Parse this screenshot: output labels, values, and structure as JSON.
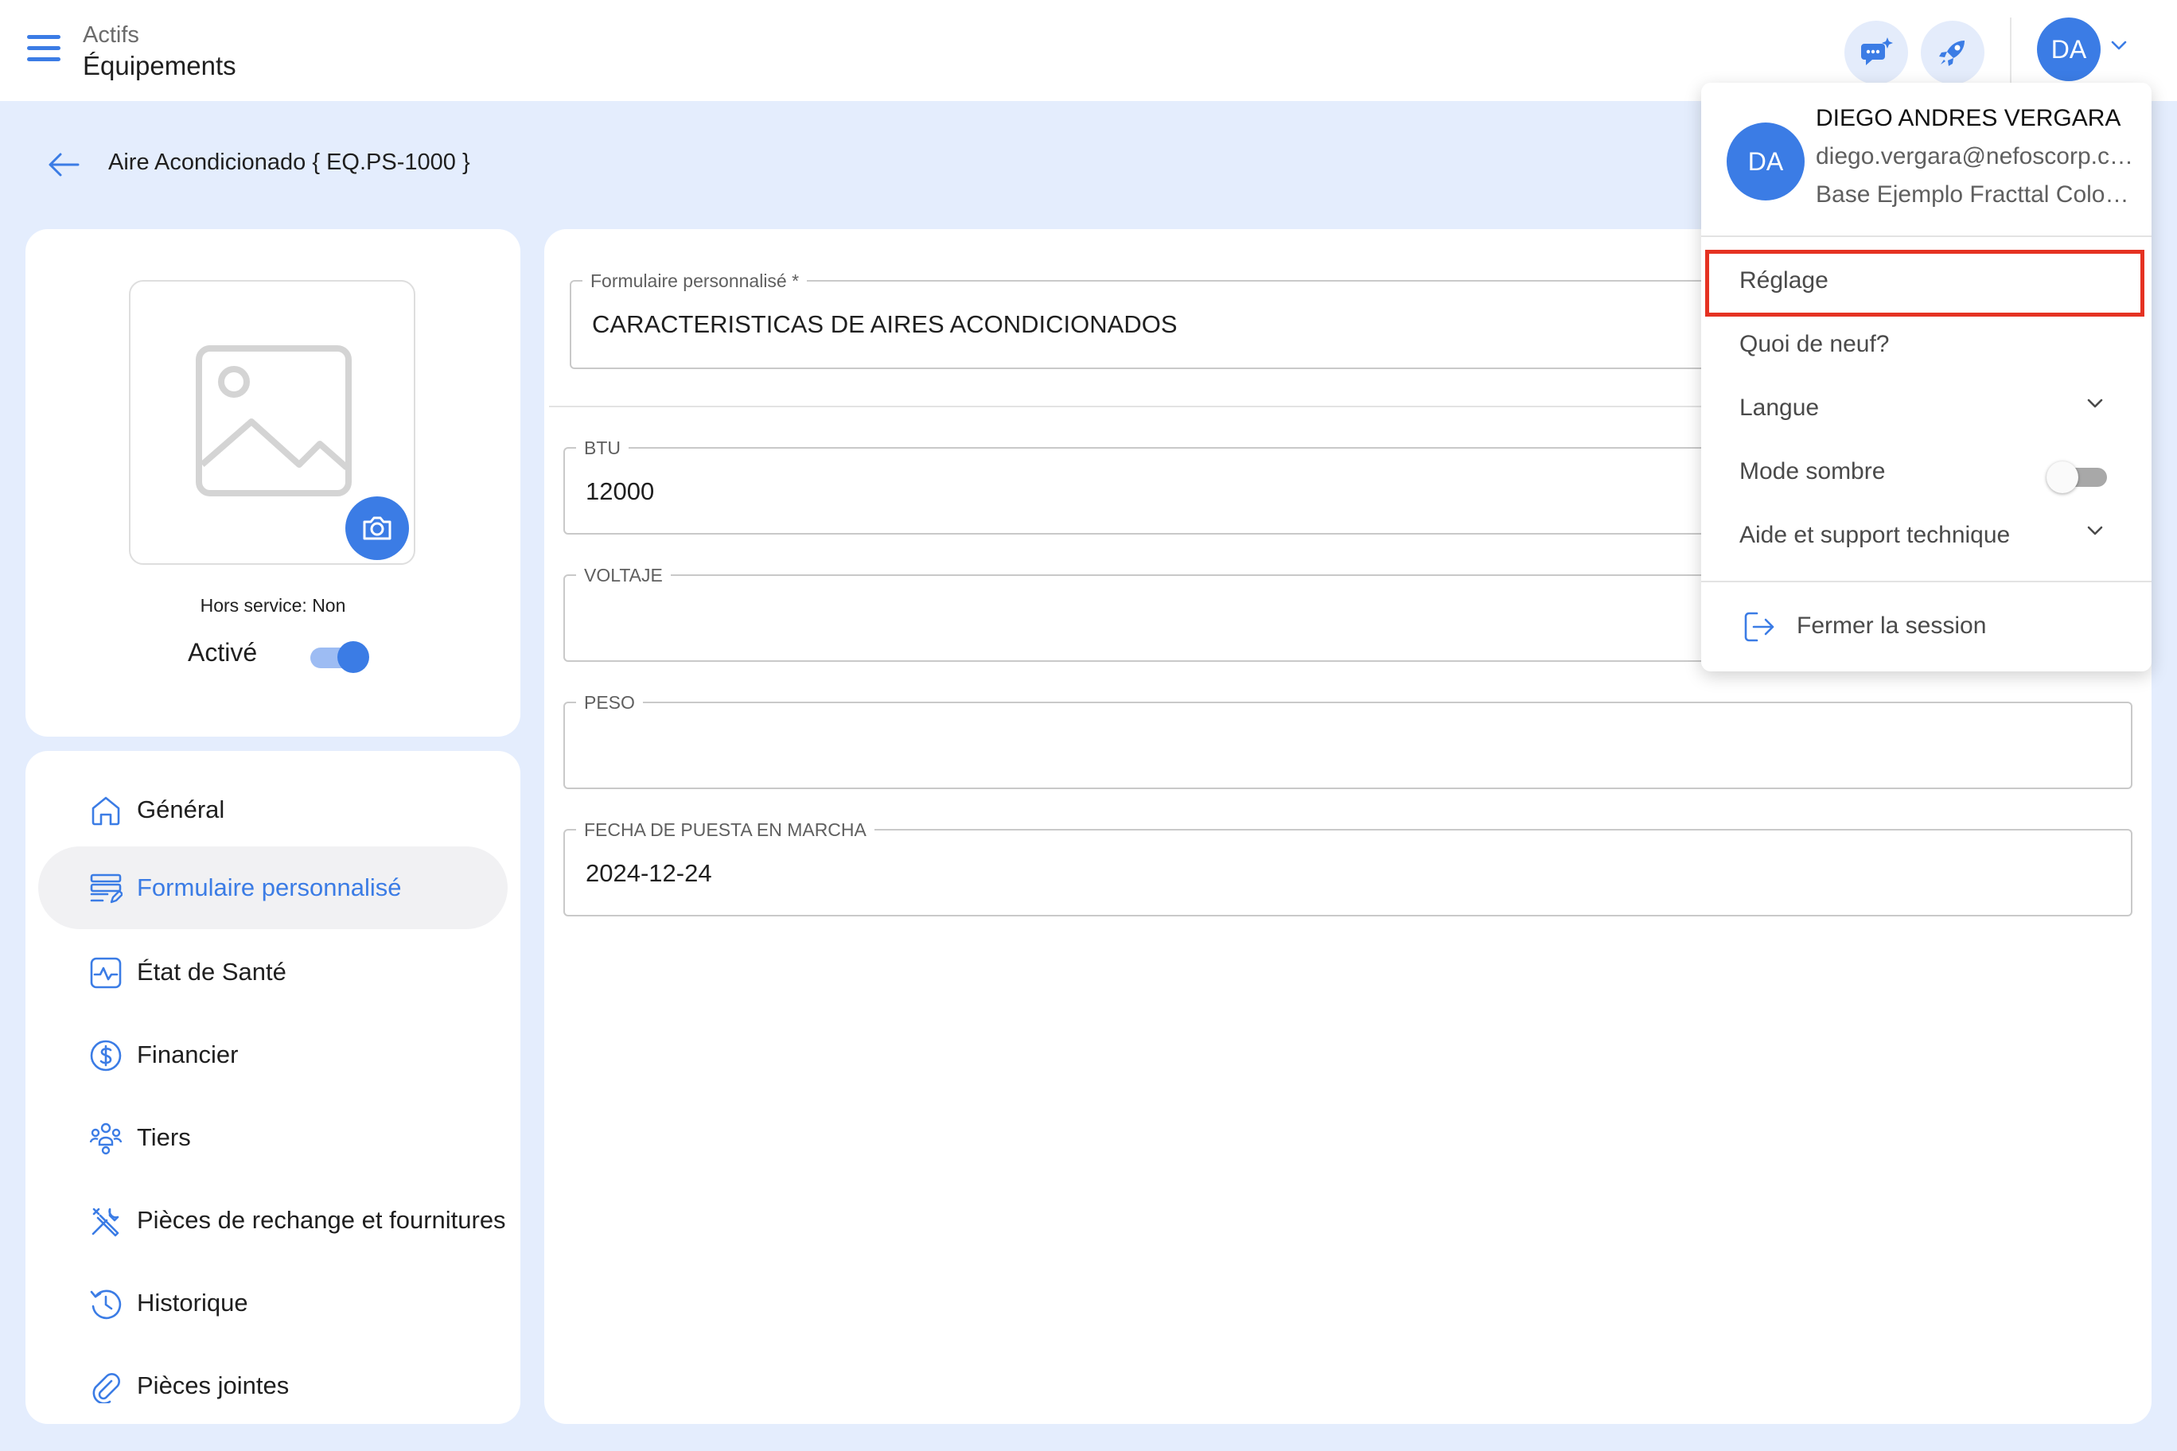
{
  "header": {
    "breadcrumb_parent": "Actifs",
    "page_title": "Équipements",
    "avatar_initials": "DA"
  },
  "asset": {
    "title": "Aire Acondicionado { EQ.PS-1000 }",
    "hors_service_label": "Hors service: Non",
    "active_label": "Activé",
    "active": true
  },
  "nav": {
    "items": [
      {
        "label": "Général",
        "icon": "home-icon",
        "active": false
      },
      {
        "label": "Formulaire personnalisé",
        "icon": "form-icon",
        "active": true
      },
      {
        "label": "État de Santé",
        "icon": "health-icon",
        "active": false
      },
      {
        "label": "Financier",
        "icon": "dollar-icon",
        "active": false
      },
      {
        "label": "Tiers",
        "icon": "people-icon",
        "active": false
      },
      {
        "label": "Pièces de rechange et fournitures",
        "icon": "tools-icon",
        "active": false
      },
      {
        "label": "Historique",
        "icon": "history-icon",
        "active": false
      },
      {
        "label": "Pièces jointes",
        "icon": "attachment-icon",
        "active": false
      }
    ]
  },
  "form": {
    "custom_form_label": "Formulaire personnalisé *",
    "custom_form_value": "CARACTERISTICAS DE AIRES ACONDICIONADOS",
    "fields": [
      {
        "label": "BTU",
        "value": "12000"
      },
      {
        "label": "VOLTAJE",
        "value": ""
      },
      {
        "label": "PESO",
        "value": ""
      },
      {
        "label": "FECHA DE PUESTA EN MARCHA",
        "value": "2024-12-24"
      }
    ]
  },
  "user_menu": {
    "avatar_initials": "DA",
    "name": "DIEGO ANDRES VERGARA",
    "email": "diego.vergara@nefoscorp.com",
    "base": "Base Ejemplo Fracttal Colombia",
    "settings_label": "Réglage",
    "whats_new_label": "Quoi de neuf?",
    "language_label": "Langue",
    "dark_mode_label": "Mode sombre",
    "dark_mode_on": false,
    "help_label": "Aide et support technique",
    "logout_label": "Fermer la session"
  },
  "colors": {
    "accent": "#3b7ce5",
    "page_background": "#e4edfd",
    "highlight": "#e53222"
  }
}
